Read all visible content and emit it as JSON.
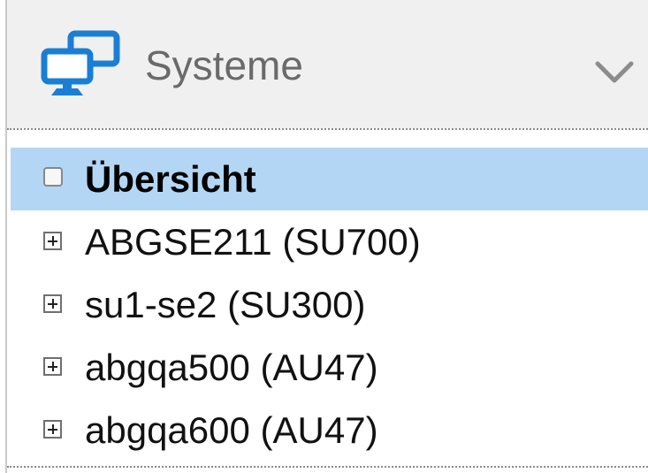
{
  "header": {
    "title": "Systeme",
    "icon": "monitors-icon",
    "toggle_icon": "chevron-down-icon"
  },
  "tree": {
    "items": [
      {
        "label": "Übersicht",
        "selected": true,
        "icon": "checkbox-icon"
      },
      {
        "label": "ABGSE211 (SU700)",
        "selected": false,
        "icon": "expand-plus-icon"
      },
      {
        "label": "su1-se2 (SU300)",
        "selected": false,
        "icon": "expand-plus-icon"
      },
      {
        "label": "abgqa500 (AU47)",
        "selected": false,
        "icon": "expand-plus-icon"
      },
      {
        "label": "abgqa600 (AU47)",
        "selected": false,
        "icon": "expand-plus-icon"
      }
    ]
  },
  "colors": {
    "header_bg": "#f0f0f0",
    "icon_blue": "#1a7fd4",
    "selected_bg": "#b3d6f5",
    "title_gray": "#6a6a6a"
  }
}
